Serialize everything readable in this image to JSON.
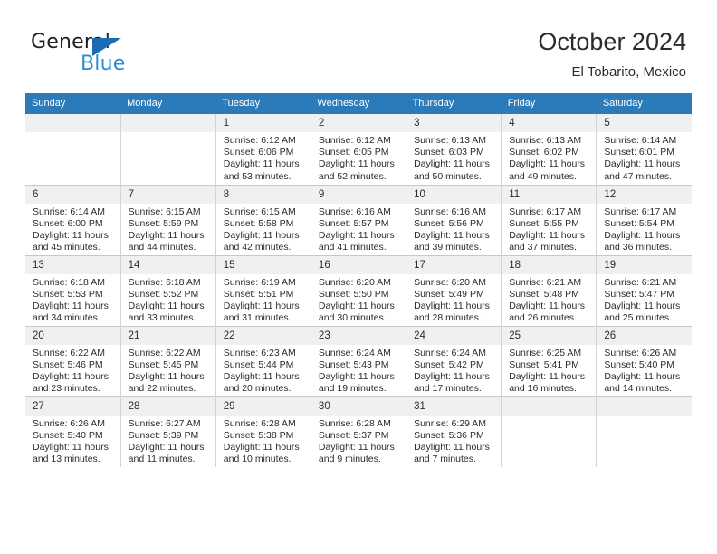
{
  "brand": {
    "name_part1": "General",
    "name_part2": "Blue",
    "triangle_icon": "triangle-icon",
    "accent_color": "#2b7bba"
  },
  "header": {
    "title": "October 2024",
    "subtitle": "El Tobarito, Mexico"
  },
  "calendar": {
    "weekday_headers": [
      "Sunday",
      "Monday",
      "Tuesday",
      "Wednesday",
      "Thursday",
      "Friday",
      "Saturday"
    ],
    "header_bg": "#2b7bba",
    "daynum_bg": "#f0f0f0",
    "weeks": [
      [
        {
          "day": "",
          "sunrise": "",
          "sunset": "",
          "daylight_line1": "",
          "daylight_line2": ""
        },
        {
          "day": "",
          "sunrise": "",
          "sunset": "",
          "daylight_line1": "",
          "daylight_line2": ""
        },
        {
          "day": "1",
          "sunrise": "Sunrise: 6:12 AM",
          "sunset": "Sunset: 6:06 PM",
          "daylight_line1": "Daylight: 11 hours",
          "daylight_line2": "and 53 minutes."
        },
        {
          "day": "2",
          "sunrise": "Sunrise: 6:12 AM",
          "sunset": "Sunset: 6:05 PM",
          "daylight_line1": "Daylight: 11 hours",
          "daylight_line2": "and 52 minutes."
        },
        {
          "day": "3",
          "sunrise": "Sunrise: 6:13 AM",
          "sunset": "Sunset: 6:03 PM",
          "daylight_line1": "Daylight: 11 hours",
          "daylight_line2": "and 50 minutes."
        },
        {
          "day": "4",
          "sunrise": "Sunrise: 6:13 AM",
          "sunset": "Sunset: 6:02 PM",
          "daylight_line1": "Daylight: 11 hours",
          "daylight_line2": "and 49 minutes."
        },
        {
          "day": "5",
          "sunrise": "Sunrise: 6:14 AM",
          "sunset": "Sunset: 6:01 PM",
          "daylight_line1": "Daylight: 11 hours",
          "daylight_line2": "and 47 minutes."
        }
      ],
      [
        {
          "day": "6",
          "sunrise": "Sunrise: 6:14 AM",
          "sunset": "Sunset: 6:00 PM",
          "daylight_line1": "Daylight: 11 hours",
          "daylight_line2": "and 45 minutes."
        },
        {
          "day": "7",
          "sunrise": "Sunrise: 6:15 AM",
          "sunset": "Sunset: 5:59 PM",
          "daylight_line1": "Daylight: 11 hours",
          "daylight_line2": "and 44 minutes."
        },
        {
          "day": "8",
          "sunrise": "Sunrise: 6:15 AM",
          "sunset": "Sunset: 5:58 PM",
          "daylight_line1": "Daylight: 11 hours",
          "daylight_line2": "and 42 minutes."
        },
        {
          "day": "9",
          "sunrise": "Sunrise: 6:16 AM",
          "sunset": "Sunset: 5:57 PM",
          "daylight_line1": "Daylight: 11 hours",
          "daylight_line2": "and 41 minutes."
        },
        {
          "day": "10",
          "sunrise": "Sunrise: 6:16 AM",
          "sunset": "Sunset: 5:56 PM",
          "daylight_line1": "Daylight: 11 hours",
          "daylight_line2": "and 39 minutes."
        },
        {
          "day": "11",
          "sunrise": "Sunrise: 6:17 AM",
          "sunset": "Sunset: 5:55 PM",
          "daylight_line1": "Daylight: 11 hours",
          "daylight_line2": "and 37 minutes."
        },
        {
          "day": "12",
          "sunrise": "Sunrise: 6:17 AM",
          "sunset": "Sunset: 5:54 PM",
          "daylight_line1": "Daylight: 11 hours",
          "daylight_line2": "and 36 minutes."
        }
      ],
      [
        {
          "day": "13",
          "sunrise": "Sunrise: 6:18 AM",
          "sunset": "Sunset: 5:53 PM",
          "daylight_line1": "Daylight: 11 hours",
          "daylight_line2": "and 34 minutes."
        },
        {
          "day": "14",
          "sunrise": "Sunrise: 6:18 AM",
          "sunset": "Sunset: 5:52 PM",
          "daylight_line1": "Daylight: 11 hours",
          "daylight_line2": "and 33 minutes."
        },
        {
          "day": "15",
          "sunrise": "Sunrise: 6:19 AM",
          "sunset": "Sunset: 5:51 PM",
          "daylight_line1": "Daylight: 11 hours",
          "daylight_line2": "and 31 minutes."
        },
        {
          "day": "16",
          "sunrise": "Sunrise: 6:20 AM",
          "sunset": "Sunset: 5:50 PM",
          "daylight_line1": "Daylight: 11 hours",
          "daylight_line2": "and 30 minutes."
        },
        {
          "day": "17",
          "sunrise": "Sunrise: 6:20 AM",
          "sunset": "Sunset: 5:49 PM",
          "daylight_line1": "Daylight: 11 hours",
          "daylight_line2": "and 28 minutes."
        },
        {
          "day": "18",
          "sunrise": "Sunrise: 6:21 AM",
          "sunset": "Sunset: 5:48 PM",
          "daylight_line1": "Daylight: 11 hours",
          "daylight_line2": "and 26 minutes."
        },
        {
          "day": "19",
          "sunrise": "Sunrise: 6:21 AM",
          "sunset": "Sunset: 5:47 PM",
          "daylight_line1": "Daylight: 11 hours",
          "daylight_line2": "and 25 minutes."
        }
      ],
      [
        {
          "day": "20",
          "sunrise": "Sunrise: 6:22 AM",
          "sunset": "Sunset: 5:46 PM",
          "daylight_line1": "Daylight: 11 hours",
          "daylight_line2": "and 23 minutes."
        },
        {
          "day": "21",
          "sunrise": "Sunrise: 6:22 AM",
          "sunset": "Sunset: 5:45 PM",
          "daylight_line1": "Daylight: 11 hours",
          "daylight_line2": "and 22 minutes."
        },
        {
          "day": "22",
          "sunrise": "Sunrise: 6:23 AM",
          "sunset": "Sunset: 5:44 PM",
          "daylight_line1": "Daylight: 11 hours",
          "daylight_line2": "and 20 minutes."
        },
        {
          "day": "23",
          "sunrise": "Sunrise: 6:24 AM",
          "sunset": "Sunset: 5:43 PM",
          "daylight_line1": "Daylight: 11 hours",
          "daylight_line2": "and 19 minutes."
        },
        {
          "day": "24",
          "sunrise": "Sunrise: 6:24 AM",
          "sunset": "Sunset: 5:42 PM",
          "daylight_line1": "Daylight: 11 hours",
          "daylight_line2": "and 17 minutes."
        },
        {
          "day": "25",
          "sunrise": "Sunrise: 6:25 AM",
          "sunset": "Sunset: 5:41 PM",
          "daylight_line1": "Daylight: 11 hours",
          "daylight_line2": "and 16 minutes."
        },
        {
          "day": "26",
          "sunrise": "Sunrise: 6:26 AM",
          "sunset": "Sunset: 5:40 PM",
          "daylight_line1": "Daylight: 11 hours",
          "daylight_line2": "and 14 minutes."
        }
      ],
      [
        {
          "day": "27",
          "sunrise": "Sunrise: 6:26 AM",
          "sunset": "Sunset: 5:40 PM",
          "daylight_line1": "Daylight: 11 hours",
          "daylight_line2": "and 13 minutes."
        },
        {
          "day": "28",
          "sunrise": "Sunrise: 6:27 AM",
          "sunset": "Sunset: 5:39 PM",
          "daylight_line1": "Daylight: 11 hours",
          "daylight_line2": "and 11 minutes."
        },
        {
          "day": "29",
          "sunrise": "Sunrise: 6:28 AM",
          "sunset": "Sunset: 5:38 PM",
          "daylight_line1": "Daylight: 11 hours",
          "daylight_line2": "and 10 minutes."
        },
        {
          "day": "30",
          "sunrise": "Sunrise: 6:28 AM",
          "sunset": "Sunset: 5:37 PM",
          "daylight_line1": "Daylight: 11 hours",
          "daylight_line2": "and 9 minutes."
        },
        {
          "day": "31",
          "sunrise": "Sunrise: 6:29 AM",
          "sunset": "Sunset: 5:36 PM",
          "daylight_line1": "Daylight: 11 hours",
          "daylight_line2": "and 7 minutes."
        },
        {
          "day": "",
          "sunrise": "",
          "sunset": "",
          "daylight_line1": "",
          "daylight_line2": ""
        },
        {
          "day": "",
          "sunrise": "",
          "sunset": "",
          "daylight_line1": "",
          "daylight_line2": ""
        }
      ]
    ]
  }
}
